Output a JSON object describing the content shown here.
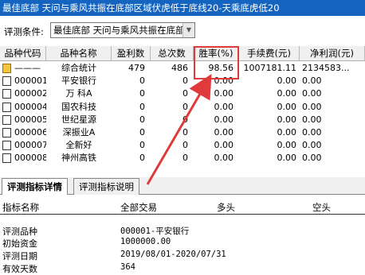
{
  "window": {
    "title": "最佳底部 天问与乘风共振在底部区域伏虎低于底线20-天乘底虎低20"
  },
  "condition": {
    "label": "评测条件:",
    "value": "最佳底部 天问与乘风共振在底部区域伏虎低于底线20-天乘底虎低20"
  },
  "table": {
    "columns": [
      "品种代码",
      "品种名称",
      "盈利数",
      "总次数",
      "胜率(%)",
      "手续费(元)",
      "净利润(元)"
    ],
    "rows": [
      {
        "code": "———",
        "name": "综合统计",
        "profit": "479",
        "total": "486",
        "winrate": "98.56",
        "fee": "1007181.11",
        "net": "2134583..."
      },
      {
        "code": "000001",
        "name": "平安银行",
        "profit": "0",
        "total": "0",
        "winrate": "0.00",
        "fee": "0.00",
        "net": "0.00"
      },
      {
        "code": "000002",
        "name": "万 科A",
        "profit": "0",
        "total": "0",
        "winrate": "0.00",
        "fee": "0.00",
        "net": "0.00"
      },
      {
        "code": "000004",
        "name": "国农科技",
        "profit": "0",
        "total": "0",
        "winrate": "0.00",
        "fee": "0.00",
        "net": "0.00"
      },
      {
        "code": "000005",
        "name": "世纪星源",
        "profit": "0",
        "total": "0",
        "winrate": "0.00",
        "fee": "0.00",
        "net": "0.00"
      },
      {
        "code": "000006",
        "name": "深振业A",
        "profit": "0",
        "total": "0",
        "winrate": "0.00",
        "fee": "0.00",
        "net": "0.00"
      },
      {
        "code": "000007",
        "name": "全新好",
        "profit": "0",
        "total": "0",
        "winrate": "0.00",
        "fee": "0.00",
        "net": "0.00"
      },
      {
        "code": "000008",
        "name": "神州高铁",
        "profit": "0",
        "total": "0",
        "winrate": "0.00",
        "fee": "0.00",
        "net": "0.00"
      }
    ]
  },
  "tabs": [
    {
      "label": "评测指标详情",
      "active": true
    },
    {
      "label": "评测指标说明",
      "active": false
    }
  ],
  "detail": {
    "headers": [
      "指标名称",
      "全部交易",
      "多头",
      "空头"
    ],
    "rows": [
      {
        "key": "评测品种",
        "value": "000001-平安银行"
      },
      {
        "key": "初始资金",
        "value": "1000000.00"
      },
      {
        "key": "评测日期",
        "value": "2019/08/01-2020/07/31"
      },
      {
        "key": "有效天数",
        "value": "364"
      }
    ]
  },
  "colors": {
    "titlebar": "#1565c0",
    "highlight": "#e03a3a"
  }
}
